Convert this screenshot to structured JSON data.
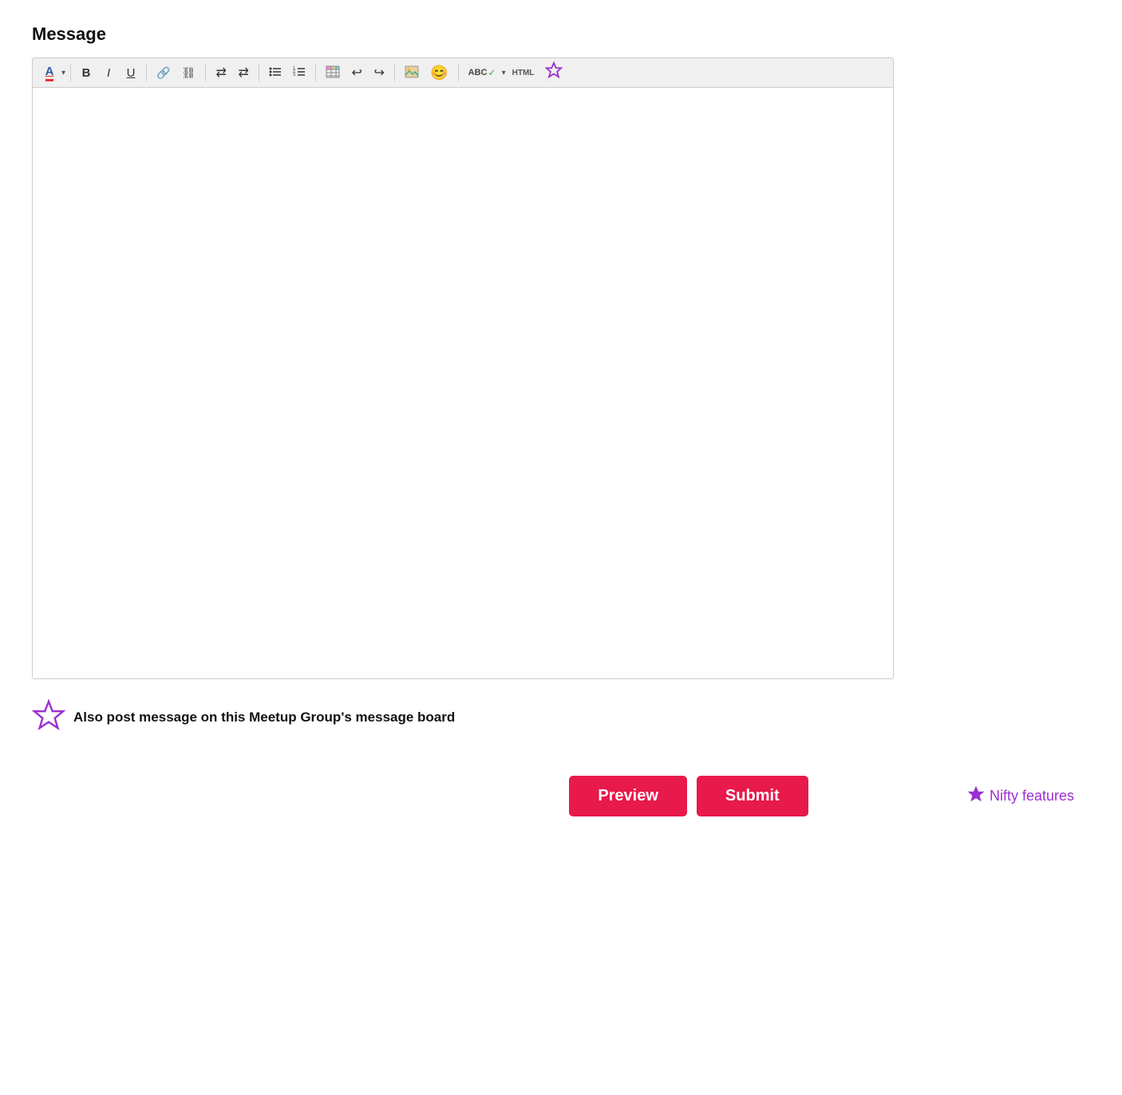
{
  "page": {
    "title": "Message"
  },
  "toolbar": {
    "buttons": [
      {
        "id": "font-color",
        "label": "A",
        "type": "font-color"
      },
      {
        "id": "bold",
        "label": "B",
        "type": "bold"
      },
      {
        "id": "italic",
        "label": "I",
        "type": "italic"
      },
      {
        "id": "underline",
        "label": "U",
        "type": "underline"
      },
      {
        "id": "link",
        "label": "",
        "type": "link"
      },
      {
        "id": "unlink",
        "label": "",
        "type": "unlink"
      },
      {
        "id": "align-left",
        "label": "",
        "type": "align-left"
      },
      {
        "id": "align-right",
        "label": "",
        "type": "align-right"
      },
      {
        "id": "unordered-list",
        "label": "",
        "type": "ul"
      },
      {
        "id": "ordered-list",
        "label": "",
        "type": "ol"
      },
      {
        "id": "table",
        "label": "",
        "type": "table"
      },
      {
        "id": "undo",
        "label": "",
        "type": "undo"
      },
      {
        "id": "redo",
        "label": "",
        "type": "redo"
      },
      {
        "id": "image",
        "label": "",
        "type": "image"
      },
      {
        "id": "emoji",
        "label": "",
        "type": "emoji"
      },
      {
        "id": "spellcheck",
        "label": "",
        "type": "spellcheck"
      },
      {
        "id": "html",
        "label": "",
        "type": "html"
      },
      {
        "id": "star",
        "label": "★",
        "type": "star"
      }
    ]
  },
  "editor": {
    "content": "",
    "placeholder": ""
  },
  "below_editor": {
    "checkbox_label": "Also post message on this Meetup Group's message board"
  },
  "actions": {
    "preview_label": "Preview",
    "submit_label": "Submit",
    "nifty_features_label": "Nifty features"
  }
}
